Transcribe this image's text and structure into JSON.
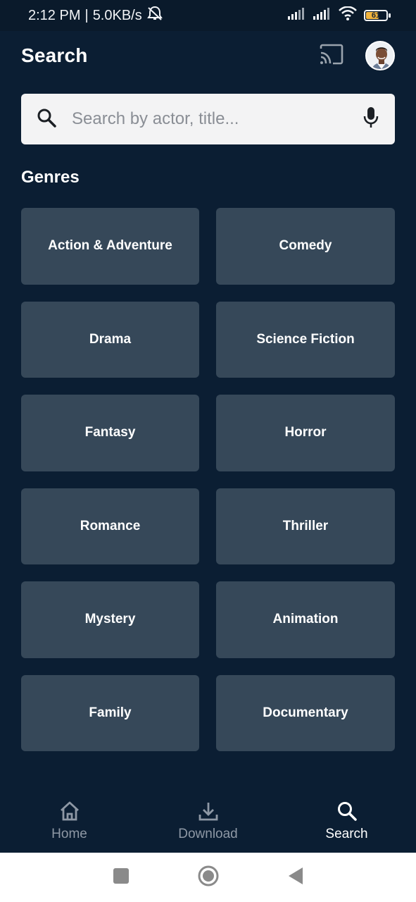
{
  "status_bar": {
    "time": "2:12 PM",
    "separator": "|",
    "speed": "5.0KB/s",
    "battery": "61"
  },
  "header": {
    "title": "Search"
  },
  "search": {
    "placeholder": "Search by actor, title..."
  },
  "genres": {
    "heading": "Genres",
    "items": [
      {
        "label": "Action & Adventure"
      },
      {
        "label": "Comedy"
      },
      {
        "label": "Drama"
      },
      {
        "label": "Science Fiction"
      },
      {
        "label": "Fantasy"
      },
      {
        "label": "Horror"
      },
      {
        "label": "Romance"
      },
      {
        "label": "Thriller"
      },
      {
        "label": "Mystery"
      },
      {
        "label": "Animation"
      },
      {
        "label": "Family"
      },
      {
        "label": "Documentary"
      }
    ]
  },
  "bottom_nav": {
    "items": [
      {
        "label": "Home",
        "icon": "home-icon"
      },
      {
        "label": "Download",
        "icon": "download-icon"
      },
      {
        "label": "Search",
        "icon": "search-icon",
        "active": true
      }
    ]
  },
  "colors": {
    "background": "#0b1e33",
    "tile": "#364859",
    "search_bg": "#f3f3f4",
    "nav_inactive": "#8e98a5",
    "battery": "#f3b53e"
  }
}
